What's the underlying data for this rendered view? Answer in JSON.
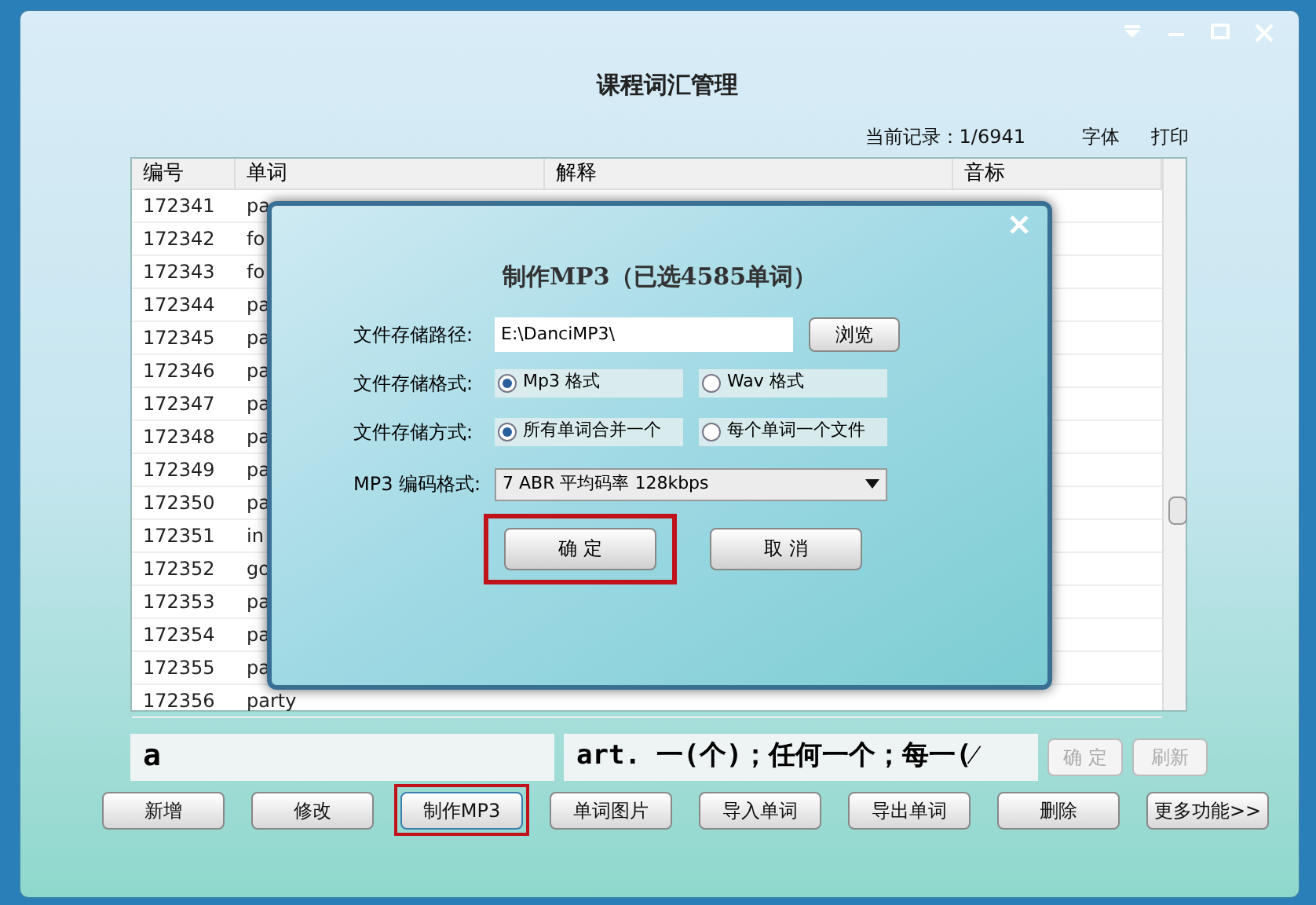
{
  "window": {
    "title": "课程词汇管理",
    "current_record": "当前记录：1/6941",
    "menu": [
      "字体",
      "打印"
    ]
  },
  "table": {
    "columns": [
      "编号",
      "单词",
      "解释",
      "音标"
    ],
    "rows": [
      {
        "id": "172341",
        "word": "pa"
      },
      {
        "id": "172342",
        "word": "fo"
      },
      {
        "id": "172343",
        "word": "fo"
      },
      {
        "id": "172344",
        "word": "pa"
      },
      {
        "id": "172345",
        "word": "pa"
      },
      {
        "id": "172346",
        "word": "pa"
      },
      {
        "id": "172347",
        "word": "pa"
      },
      {
        "id": "172348",
        "word": "pa"
      },
      {
        "id": "172349",
        "word": "pa"
      },
      {
        "id": "172350",
        "word": "pa"
      },
      {
        "id": "172351",
        "word": "in"
      },
      {
        "id": "172352",
        "word": "go"
      },
      {
        "id": "172353",
        "word": "pa"
      },
      {
        "id": "172354",
        "word": "pa"
      },
      {
        "id": "172355",
        "word": "pa"
      },
      {
        "id": "172356",
        "word": "party"
      }
    ]
  },
  "word_field": {
    "value": "a"
  },
  "meaning_field": {
    "value": "art. 一(个)；任何一个；每一(⁄"
  },
  "edit_buttons": [
    {
      "label": "确 定",
      "disabled": true
    },
    {
      "label": "刷新",
      "disabled": true
    }
  ],
  "buttons": [
    {
      "label": "新增",
      "highlighted": false
    },
    {
      "label": "修改",
      "highlighted": false
    },
    {
      "label": "制作MP3",
      "highlighted": true
    },
    {
      "label": "单词图片",
      "highlighted": false
    },
    {
      "label": "导入单词",
      "highlighted": false
    },
    {
      "label": "导出单词",
      "highlighted": false
    },
    {
      "label": "删除",
      "highlighted": false
    },
    {
      "label": "更多功能>>",
      "highlighted": false
    }
  ],
  "dialog": {
    "title": "制作MP3（已选4585单词）",
    "path_label": "文件存储路径:",
    "path_value": "E:\\DanciMP3\\",
    "browse": "浏览",
    "radio_groups": [
      {
        "label": "文件存储格式:",
        "options": [
          {
            "label": "Mp3 格式",
            "selected": true
          },
          {
            "label": "Wav 格式",
            "selected": false
          }
        ]
      },
      {
        "label": "文件存储方式:",
        "options": [
          {
            "label": "所有单词合并一个",
            "selected": true
          },
          {
            "label": "每个单词一个文件",
            "selected": false
          }
        ]
      }
    ],
    "encoding_label": "MP3 编码格式:",
    "encoding_value": "7 ABR 平均码率 128kbps",
    "buttons": [
      {
        "label": "确 定",
        "highlighted": true
      },
      {
        "label": "取 消",
        "highlighted": false
      }
    ]
  }
}
